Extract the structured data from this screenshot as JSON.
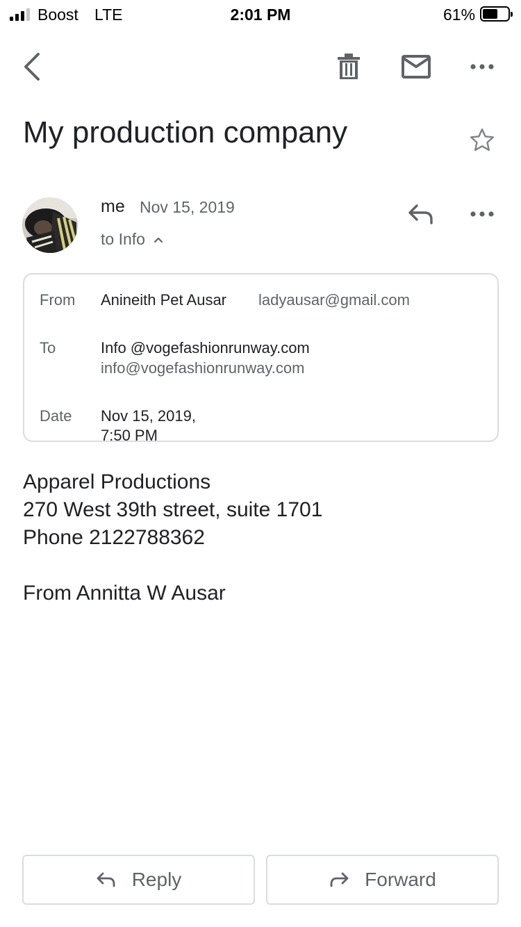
{
  "status_bar": {
    "carrier": "Boost",
    "network": "LTE",
    "time": "2:01 PM",
    "battery_percent": "61%",
    "battery_level": 0.61
  },
  "toolbar": {
    "back_icon": "chevron-left-icon",
    "delete_icon": "trash-icon",
    "mark_unread_icon": "envelope-icon",
    "more_icon": "more-horizontal-icon"
  },
  "email": {
    "subject": "My production company",
    "star_icon": "star-outline-icon",
    "sender": {
      "name": "me",
      "date": "Nov 15, 2019",
      "recipient_summary": "to Info"
    },
    "details": {
      "from_label": "From",
      "from_name": "Anineith Pet Ausar",
      "from_email": "ladyausar@gmail.com",
      "to_label": "To",
      "to_name": "Info @vogefashionrunway.com",
      "to_email": "info@vogefashionrunway.com",
      "date_label": "Date",
      "date_line1": "Nov 15, 2019,",
      "date_line2": "7:50 PM"
    },
    "body": [
      "Apparel Productions",
      "270 West 39th street, suite 1701",
      "Phone 2122788362",
      "",
      "From Annitta W Ausar"
    ]
  },
  "actions": {
    "reply_label": "Reply",
    "forward_label": "Forward"
  },
  "colors": {
    "text_primary": "#202124",
    "text_secondary": "#5f6368",
    "border": "#dadce0"
  }
}
